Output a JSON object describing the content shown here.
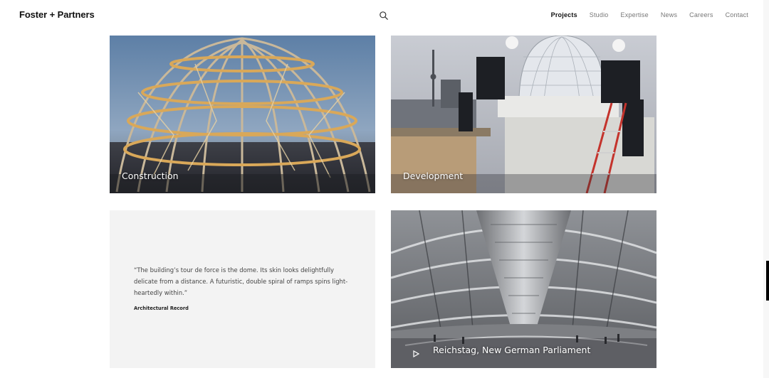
{
  "header": {
    "logo": "Foster + Partners",
    "search_icon": "search-icon",
    "nav": [
      {
        "label": "Projects",
        "active": true
      },
      {
        "label": "Studio",
        "active": false
      },
      {
        "label": "Expertise",
        "active": false
      },
      {
        "label": "News",
        "active": false
      },
      {
        "label": "Careers",
        "active": false
      },
      {
        "label": "Contact",
        "active": false
      }
    ]
  },
  "tiles": {
    "construction": {
      "label": "Construction"
    },
    "development": {
      "label": "Development"
    },
    "quote": {
      "lines": [
        "“The building’s tour de force is the dome. Its skin looks delightfully",
        "delicate from a distance. A futuristic, double spiral of ramps spins light-",
        "heartedly within.”"
      ],
      "source": "Architectural Record"
    },
    "reichstag": {
      "label": "Reichstag, New German Parliament",
      "icon": "play-icon"
    }
  },
  "colors": {
    "accent": "#111111",
    "nav_inactive": "#777777",
    "quote_bg": "#f3f3f3"
  }
}
